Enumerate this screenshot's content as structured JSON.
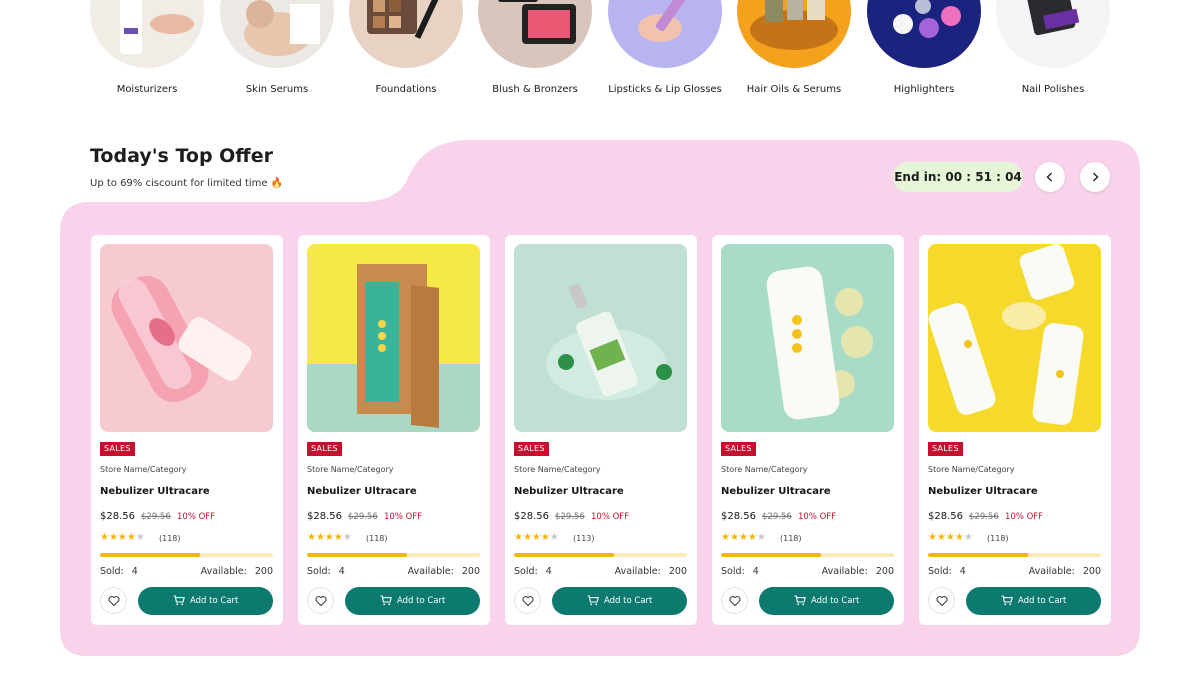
{
  "categories": [
    {
      "label": "Moisturizers",
      "icon": "moisturizer-photo"
    },
    {
      "label": "Skin Serums",
      "icon": "skin-serum-photo"
    },
    {
      "label": "Foundations",
      "icon": "foundation-photo"
    },
    {
      "label": "Blush & Bronzers",
      "icon": "blush-photo"
    },
    {
      "label": "Lipsticks & Lip Glosses",
      "icon": "lipstick-photo"
    },
    {
      "label": "Hair Oils & Serums",
      "icon": "hair-oil-photo"
    },
    {
      "label": "Highlighters",
      "icon": "highlighter-photo"
    },
    {
      "label": "Nail Polishes",
      "icon": "nail-polish-photo"
    }
  ],
  "offer": {
    "title": "Today's Top Offer",
    "subtitle": "Up to 69% ciscount for limited time 🔥",
    "timer": "End in: 00 : 51 : 04",
    "accent_color": "#f9d3eb",
    "button_color": "#0d7a6f"
  },
  "products": [
    {
      "badge": "SALES",
      "store": "Store Name/Category",
      "name": "Nebulizer Ultracare",
      "price": "$28.56",
      "old_price": "$29.56",
      "discount": "10% OFF",
      "rating": 4,
      "reviews": "(118)",
      "sold_label": "Sold:",
      "sold": "4",
      "available_label": "Available:",
      "available": "200",
      "sold_fraction": 0.58,
      "cart_label": "Add to Cart"
    },
    {
      "badge": "SALES",
      "store": "Store Name/Category",
      "name": "Nebulizer Ultracare",
      "price": "$28.56",
      "old_price": "$29.56",
      "discount": "10% OFF",
      "rating": 4,
      "reviews": "(118)",
      "sold_label": "Sold:",
      "sold": "4",
      "available_label": "Available:",
      "available": "200",
      "sold_fraction": 0.58,
      "cart_label": "Add to Cart"
    },
    {
      "badge": "SALES",
      "store": "Store Name/Category",
      "name": "Nebulizer Ultracare",
      "price": "$28.56",
      "old_price": "$29.56",
      "discount": "10% OFF",
      "rating": 4,
      "reviews": "(113)",
      "sold_label": "Sold:",
      "sold": "4",
      "available_label": "Available:",
      "available": "200",
      "sold_fraction": 0.58,
      "cart_label": "Add to Cart"
    },
    {
      "badge": "SALES",
      "store": "Store Name/Category",
      "name": "Nebulizer Ultracare",
      "price": "$28.56",
      "old_price": "$29.56",
      "discount": "10% OFF",
      "rating": 4,
      "reviews": "(118)",
      "sold_label": "Sold:",
      "sold": "4",
      "available_label": "Available:",
      "available": "200",
      "sold_fraction": 0.58,
      "cart_label": "Add to Cart"
    },
    {
      "badge": "SALES",
      "store": "Store Name/Category",
      "name": "Nebulizer Ultracare",
      "price": "$28.56",
      "old_price": "$29.56",
      "discount": "10% OFF",
      "rating": 4,
      "reviews": "(118)",
      "sold_label": "Sold:",
      "sold": "4",
      "available_label": "Available:",
      "available": "200",
      "sold_fraction": 0.58,
      "cart_label": "Add to Cart"
    }
  ]
}
